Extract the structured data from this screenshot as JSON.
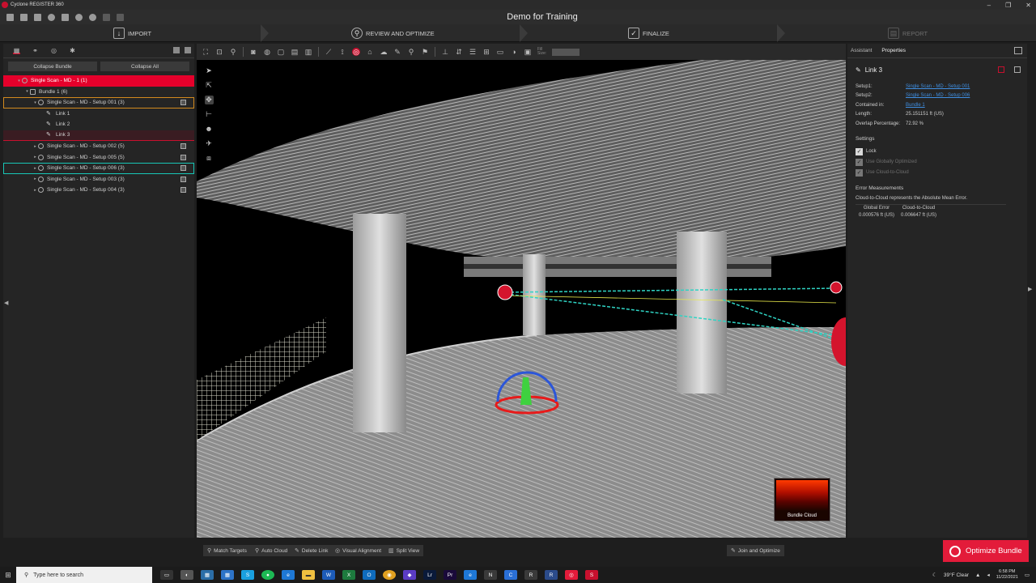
{
  "window": {
    "app_title": "Cyclone REGISTER 360",
    "doc_title": "Demo for Training",
    "controls": [
      "–",
      "❐",
      "✕"
    ]
  },
  "workflow": {
    "steps": [
      {
        "label": "IMPORT"
      },
      {
        "label": "REVIEW AND OPTIMIZE"
      },
      {
        "label": "FINALIZE"
      },
      {
        "label": "REPORT"
      }
    ]
  },
  "left_panel": {
    "collapse_bundle": "Collapse Bundle",
    "collapse_all": "Collapse All",
    "tree": [
      {
        "label": "Single Scan - MD - 1 (1)",
        "level": 0,
        "state": "selected-red",
        "icon": "scan-icon"
      },
      {
        "label": "Bundle 1 (6)",
        "level": 1,
        "state": "",
        "icon": "bundle-icon"
      },
      {
        "label": "Single Scan - MD - Setup 001 (3)",
        "level": 2,
        "state": "selected-orange",
        "icon": "setup-icon"
      },
      {
        "label": "Link 1",
        "level": 3,
        "state": "",
        "icon": "link-icon"
      },
      {
        "label": "Link 2",
        "level": 3,
        "state": "",
        "icon": "link-icon"
      },
      {
        "label": "Link 3",
        "level": 3,
        "state": "selected-darkred",
        "icon": "link-icon"
      },
      {
        "label": "Single Scan - MD - Setup 002 (5)",
        "level": 2,
        "state": "",
        "icon": "setup-icon"
      },
      {
        "label": "Single Scan - MD - Setup 005 (5)",
        "level": 2,
        "state": "",
        "icon": "setup-icon"
      },
      {
        "label": "Single Scan - MD - Setup 006 (3)",
        "level": 2,
        "state": "selected-teal",
        "icon": "setup-icon"
      },
      {
        "label": "Single Scan - MD - Setup 003 (3)",
        "level": 2,
        "state": "",
        "icon": "setup-icon"
      },
      {
        "label": "Single Scan - MD - Setup 004 (3)",
        "level": 2,
        "state": "",
        "icon": "setup-icon"
      }
    ]
  },
  "viewport": {
    "toolbar_field_label": "Fill\nSize:",
    "minimap_label": "Bundle Cloud"
  },
  "bottom_bar": {
    "buttons": [
      "Match Targets",
      "Auto Cloud",
      "Delete Link",
      "Visual Alignment",
      "Split View"
    ],
    "join_optimize": "Join and Optimize"
  },
  "right_panel": {
    "tabs": [
      "Assistant",
      "Properties"
    ],
    "title": "Link 3",
    "props": {
      "setup1_key": "Setup1:",
      "setup1_val": "Single Scan - MD - Setup 001",
      "setup2_key": "Setup2:",
      "setup2_val": "Single Scan - MD - Setup 006",
      "contained_key": "Contained in:",
      "contained_val": "Bundle 1",
      "length_key": "Length:",
      "length_val": "25.151151 ft (US)",
      "overlap_key": "Overlap Percentage:",
      "overlap_val": "72.92 %"
    },
    "settings_header": "Settings",
    "settings": [
      {
        "label": "Lock",
        "checked": true,
        "enabled": true
      },
      {
        "label": "Use Globally Optimized",
        "checked": true,
        "enabled": false
      },
      {
        "label": "Use Cloud-to-Cloud",
        "checked": true,
        "enabled": false
      }
    ],
    "errors_header": "Error Measurements",
    "errors_note": "Cloud-to-Cloud represents the Absolute Mean Error.",
    "errors_cols": [
      "Global Error",
      "Cloud-to-Cloud"
    ],
    "errors_vals": [
      "0.000576 ft (US)",
      "0.006647 ft (US)"
    ]
  },
  "optimize_button": "Optimize Bundle",
  "taskbar": {
    "search_placeholder": "Type here to search",
    "weather": "39°F  Clear",
    "time": "6:58 PM",
    "date": "11/22/2021"
  },
  "colors": {
    "accent": "#e31b3a",
    "link": "#3f8ee0",
    "teal": "#18c6b6",
    "orange": "#d28a1e"
  }
}
